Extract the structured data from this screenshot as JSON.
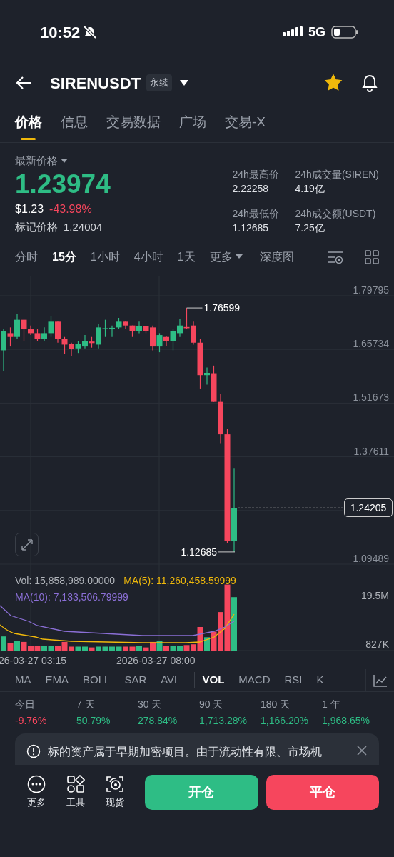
{
  "status_bar": {
    "time": "10:52",
    "network": "5G"
  },
  "header": {
    "symbol": "SIRENUSDT",
    "badge": "永续",
    "favorite": true
  },
  "tabs": [
    {
      "label": "价格",
      "selected": true
    },
    {
      "label": "信息",
      "selected": false
    },
    {
      "label": "交易数据",
      "selected": false
    },
    {
      "label": "广场",
      "selected": false
    },
    {
      "label": "交易-X",
      "selected": false
    }
  ],
  "price": {
    "label": "最新价格",
    "last": "1.23974",
    "usd": "$1.23",
    "change": "-43.98%",
    "mark_label": "标记价格",
    "mark": "1.24004"
  },
  "stats": [
    {
      "label": "24h最高价",
      "value": "2.22258"
    },
    {
      "label": "24h成交量(SIREN)",
      "value": "4.19亿"
    },
    {
      "label": "24h最低价",
      "value": "1.12685"
    },
    {
      "label": "24h成交额(USDT)",
      "value": "7.25亿"
    }
  ],
  "intervals": [
    {
      "label": "分时",
      "selected": false,
      "kind": "plain"
    },
    {
      "label": "15分",
      "selected": true,
      "kind": "plain"
    },
    {
      "label": "1小时",
      "selected": false,
      "kind": "plain"
    },
    {
      "label": "4小时",
      "selected": false,
      "kind": "plain"
    },
    {
      "label": "1天",
      "selected": false,
      "kind": "plain"
    },
    {
      "label": "更多",
      "selected": false,
      "kind": "dropdown"
    },
    {
      "label": "深度图",
      "selected": false,
      "kind": "plain"
    }
  ],
  "chart": {
    "y_ticks": [
      "1.79795",
      "1.65734",
      "1.51673",
      "1.37611",
      "1.09489"
    ],
    "high_marker": "1.76599",
    "low_marker": "1.12685",
    "last_price": "1.24205"
  },
  "volume": {
    "vol": "Vol: 15,858,989.00000",
    "ma5": "MA(5): 11,260,458.59999",
    "ma10": "MA(10): 7,133,506.79999",
    "y_ticks": [
      "19.5M",
      "827K"
    ],
    "x_labels": [
      "26-03-27 03:15",
      "2026-03-27 08:00"
    ]
  },
  "indicators": [
    {
      "label": "MA",
      "selected": false
    },
    {
      "label": "EMA",
      "selected": false
    },
    {
      "label": "BOLL",
      "selected": false
    },
    {
      "label": "SAR",
      "selected": false
    },
    {
      "label": "AVL",
      "selected": false
    },
    {
      "label": "VOL",
      "selected": true
    },
    {
      "label": "MACD",
      "selected": false
    },
    {
      "label": "RSI",
      "selected": false
    },
    {
      "label": "K",
      "selected": false
    }
  ],
  "returns": [
    {
      "label": "今日",
      "value": "-9.76%",
      "negative": true
    },
    {
      "label": "7 天",
      "value": "50.79%",
      "negative": false
    },
    {
      "label": "30 天",
      "value": "278.84%",
      "negative": false
    },
    {
      "label": "90 天",
      "value": "1,713.28%",
      "negative": false
    },
    {
      "label": "180 天",
      "value": "1,166.20%",
      "negative": false
    },
    {
      "label": "1 年",
      "value": "1,968.65%",
      "negative": false
    }
  ],
  "notice": {
    "text": "标的资产属于早期加密项目。由于流动性有限、市场机"
  },
  "toolbar": [
    {
      "label": "更多",
      "kind": "more"
    },
    {
      "label": "工具",
      "kind": "tools"
    },
    {
      "label": "现货",
      "kind": "spot"
    }
  ],
  "actions": [
    {
      "label": "开仓",
      "kind": "long"
    },
    {
      "label": "平仓",
      "kind": "short"
    }
  ]
}
